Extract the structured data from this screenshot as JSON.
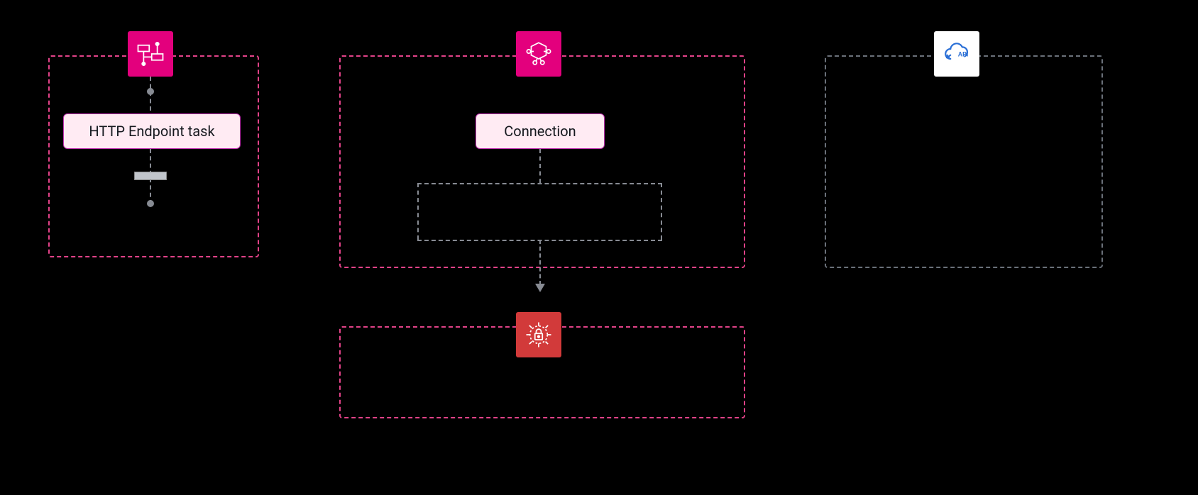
{
  "colors": {
    "pink_border": "#e24288",
    "gray_border": "#6a7079",
    "magenta_badge": "#e3007d",
    "red_badge": "#d23a3a",
    "white_badge": "#ffffff",
    "node_fill": "#ffebf3",
    "node_border": "#c031b0"
  },
  "stepfunctions": {
    "task_label": "HTTP Endpoint task"
  },
  "eventbridge": {
    "connection_label": "Connection"
  },
  "icons": {
    "stepfunctions": "workflow-icon",
    "eventbridge": "eventbridge-icon",
    "secretsmanager": "secrets-manager-icon",
    "api": "api-cloud-icon"
  }
}
